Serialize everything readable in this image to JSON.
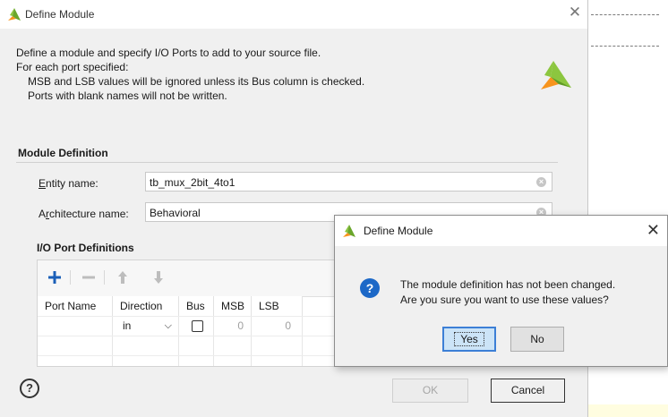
{
  "main_dialog": {
    "title": "Define Module",
    "description": {
      "line1": "Define a module and specify I/O Ports to add to your source file.",
      "line2": "For each port specified:",
      "line3": "MSB and LSB values will be ignored unless its Bus column is checked.",
      "line4": "Ports with blank names will not be written."
    },
    "module_definition": {
      "heading": "Module Definition",
      "entity_label": "Entity name:",
      "entity_value": "tb_mux_2bit_4to1",
      "architecture_label": "Architecture name:",
      "architecture_value": "Behavioral"
    },
    "io_ports": {
      "heading": "I/O Port Definitions",
      "toolbar": {
        "add": "+",
        "remove": "—",
        "up": "🡅",
        "down": "🡇"
      },
      "columns": [
        "Port Name",
        "Direction",
        "Bus",
        "MSB",
        "LSB"
      ],
      "rows": [
        {
          "port_name": "",
          "direction": "in",
          "bus": false,
          "msb": "0",
          "lsb": "0"
        }
      ]
    },
    "buttons": {
      "help": "?",
      "ok": "OK",
      "cancel": "Cancel"
    }
  },
  "confirm_dialog": {
    "title": "Define Module",
    "message_line1": "The module definition has not been changed.",
    "message_line2": "Are you sure you want to use these values?",
    "icon": "question-icon",
    "yes_label": "Yes",
    "no_label": "No"
  },
  "colors": {
    "logo_green": "#8cc63f",
    "logo_orange": "#f7941d",
    "accent_blue": "#1c68c7",
    "toolbar_blue": "#1b5fb8"
  }
}
